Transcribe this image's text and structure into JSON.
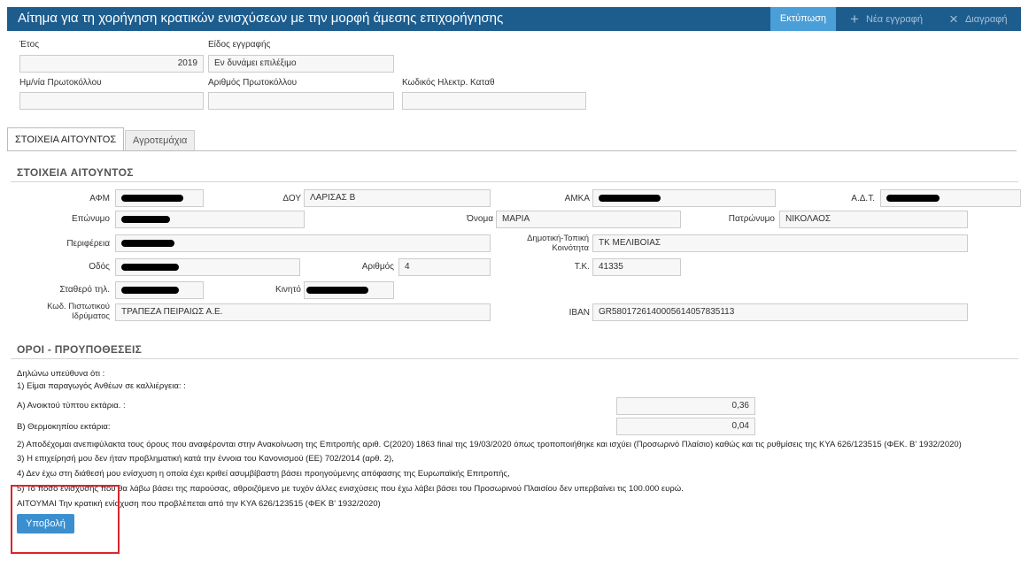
{
  "header": {
    "title": "Αίτημα για τη χορήγηση κρατικών ενισχύσεων με την μορφή άμεσης επιχορήγησης",
    "print_label": "Εκτύπωση",
    "new_label": "Νέα εγγραφή",
    "delete_label": "Διαγραφή",
    "new_icon": "plus-icon",
    "delete_icon": "close-icon",
    "bar_color": "#1d5d8e",
    "accent_color": "#4a9fd8"
  },
  "record": {
    "year_label": "Έτος",
    "year_value": "2019",
    "type_label": "Είδος εγγραφής",
    "type_value": "Εν δυνάμει επιλέξιμο",
    "protocol_date_label": "Ημ/νία Πρωτοκόλλου",
    "protocol_date_value": "",
    "protocol_number_label": "Αριθμός Πρωτοκόλλου",
    "protocol_number_value": "",
    "electronic_code_label": "Κωδικός Ηλεκτρ. Καταθ",
    "electronic_code_value": ""
  },
  "tabs": [
    {
      "label": "ΣΤΟΙΧΕΙΑ ΑΙΤΟΥΝΤΟΣ",
      "active": true
    },
    {
      "label": "Αγροτεμάχια",
      "active": false
    }
  ],
  "applicant": {
    "section_title": "ΣΤΟΙΧΕΙΑ ΑΙΤΟΥΝΤΟΣ",
    "afm_label": "ΑΦΜ",
    "doy_label": "ΔΟΥ",
    "doy_value": "ΛΑΡΙΣΑΣ Β",
    "amka_label": "ΑΜΚΑ",
    "adt_label": "Α.Δ.Τ.",
    "surname_label": "Επώνυμο",
    "name_label": "Όνομα",
    "name_value": "ΜΑΡΙΑ",
    "father_label": "Πατρώνυμο",
    "father_value": "ΝΙΚΟΛΑΟΣ",
    "region_label": "Περιφέρεια",
    "community_label_1": "Δημοτική-Τοπική",
    "community_label_2": "Κοινότητα",
    "community_value": "ΤΚ ΜΕΛΙΒΟΙΑΣ",
    "street_label": "Οδός",
    "number_label": "Αριθμός",
    "number_value": "4",
    "postal_label": "Τ.Κ.",
    "postal_value": "41335",
    "landline_label": "Σταθερό τηλ.",
    "mobile_label": "Κινητό",
    "bank_label_1": "Κωδ. Πιστωτικού",
    "bank_label_2": "Ιδρύματος",
    "bank_value": "ΤΡΑΠΕΖΑ ΠΕΙΡΑΙΩΣ Α.Ε.",
    "iban_label": "IBAN",
    "iban_value": "GR5801726140005614057835113"
  },
  "terms": {
    "section_title": "ΟΡΟΙ - ΠΡΟΥΠΟΘΕΣΕΙΣ",
    "declare": "Δηλώνω υπεύθυνα ότι :",
    "item1": "1) Είμαι παραγωγός Ανθέων σε καλλιέργεια: :",
    "open_label": "Α) Ανοικτού τύπτου εκτάρια. :",
    "open_value": "0,36",
    "greenhouse_label": "Β) Θερμοκηπίου εκτάρια:",
    "greenhouse_value": "0,04",
    "item2": "2) Αποδέχομαι ανεπιφύλακτα τους όρους που αναφέρονται στην Ανακοίνωση της Επιτροπής αριθ. C(2020) 1863 final της 19/03/2020 όπως τροποποιήθηκε και ισχύει (Προσωρινό Πλαίσιο) καθώς και τις ρυθμίσεις της ΚΥΑ 626/123515 (ΦΕΚ. Β' 1932/2020)",
    "item3": "3) Η επιχείρησή μου δεν ήταν προβληματική κατά την έννοια του Κανονισμού (ΕΕ) 702/2014 (αρθ. 2),",
    "item4": "4) Δεν έχω στη διάθεσή μου ενίσχυση η οποία έχει κριθεί ασυμβίβαστη βάσει προηγούμενης απόφασης της Ευρωπαϊκής Επιτροπής,",
    "item5": "5) Το ποσό ενίσχυσης που θα λάβω βάσει της παρούσας, αθροιζόμενο με τυχόν άλλες ενισχύσεις που έχω λάβει βάσει του Προσωρινού Πλαισίου δεν υπερβαίνει τις 100.000 ευρώ.",
    "request": "ΑΙΤΟΥΜΑΙ Την κρατική ενίσχυση που προβλέπεται από την ΚΥΑ 626/123515 (ΦΕΚ Β' 1932/2020)",
    "submit_label": "Υποβολή"
  }
}
